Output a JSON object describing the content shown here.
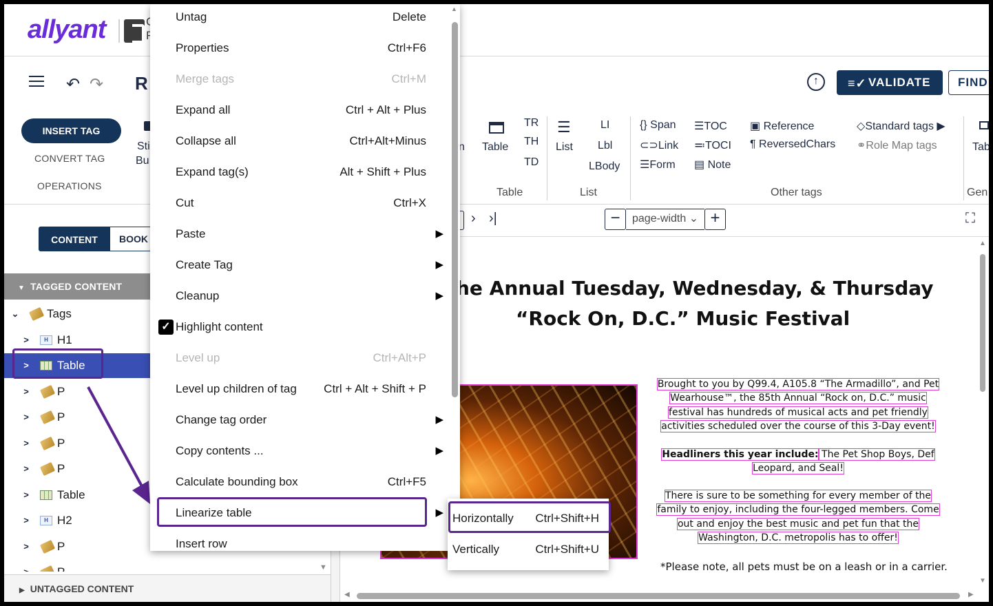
{
  "header": {
    "logo": "allyant",
    "logo_tail": "C\nF",
    "doc_title": "R",
    "validate_label": "VALIDATE",
    "find_label": "FIND"
  },
  "ribbon_left": {
    "insert_tag": "INSERT TAG",
    "convert_tag": "CONVERT TAG",
    "operations": "OPERATIONS",
    "partial_1": "Sti",
    "partial_2": "Bu"
  },
  "ribbon_right": {
    "partial_n": "n",
    "table_btn": "Table",
    "tr": "TR",
    "th": "TH",
    "td": "TD",
    "table_group": "Table",
    "list_btn": "List",
    "li": "LI",
    "lbl": "Lbl",
    "lbody": "LBody",
    "list_group": "List",
    "span": "Span",
    "link": "Link",
    "form": "Form",
    "toc": "TOC",
    "toci": "TOCI",
    "note": "Note",
    "reference": "Reference",
    "reversedchars": "ReversedChars",
    "standard_tags": "Standard tags",
    "role_map_tags": "Role Map tags",
    "other_group": "Other tags",
    "tab_partial": "Tab",
    "gen_partial": "Gen"
  },
  "left_panel": {
    "tab_content": "CONTENT",
    "tab_book": "BOOK",
    "tagged_header": "TAGGED CONTENT",
    "untagged_header": "UNTAGGED CONTENT",
    "tree": [
      {
        "label": "Tags",
        "icon": "tag-icon",
        "level": 0
      },
      {
        "label": "H1",
        "icon": "heading-icon",
        "level": 1
      },
      {
        "label": "Table",
        "icon": "table-icon",
        "level": 1,
        "selected": true
      },
      {
        "label": "P",
        "icon": "tag-icon",
        "level": 1
      },
      {
        "label": "P",
        "icon": "tag-icon",
        "level": 1
      },
      {
        "label": "P",
        "icon": "tag-icon",
        "level": 1
      },
      {
        "label": "P",
        "icon": "tag-icon",
        "level": 1
      },
      {
        "label": "Table",
        "icon": "table-icon",
        "level": 1
      },
      {
        "label": "H2",
        "icon": "heading-icon",
        "level": 1
      },
      {
        "label": "P",
        "icon": "tag-icon",
        "level": 1
      },
      {
        "label": "P",
        "icon": "tag-icon",
        "level": 1
      }
    ]
  },
  "doc_toolbar": {
    "zoom_value": "page-width"
  },
  "document": {
    "heading_1": "he Annual Tuesday, Wednesday, & Thursday",
    "heading_2": "“Rock On, D.C.” Music Festival",
    "para1": [
      "Brought to you by Q99.4, A105.8 “The Armadillo”, and Pet",
      "Wearhouse™, the 85th Annual “Rock on, D.C.” music",
      "festival has hundreds of musical acts and pet friendly",
      "activities scheduled over the course of this 3-Day event!"
    ],
    "para2_bold": "Headliners this year include:",
    "para2_rest": " The Pet Shop Boys, Def",
    "para2_line2": "Leopard, and Seal!",
    "para3": [
      "There is sure to be something for every member of the",
      "family to enjoy, including the four-legged members.  Come",
      "out and enjoy the best music and pet fun that the",
      "Washington, D.C. metropolis has to offer!"
    ],
    "note": "*Please note, all pets must be on a leash or in a carrier."
  },
  "context_menu": [
    {
      "label": "Untag",
      "shortcut": "Delete",
      "disabled": false
    },
    {
      "label": "Properties",
      "shortcut": "Ctrl+F6",
      "disabled": false
    },
    {
      "label": "Merge tags",
      "shortcut": "Ctrl+M",
      "disabled": true
    },
    {
      "label": "Expand all",
      "shortcut": "Ctrl + Alt + Plus",
      "disabled": false
    },
    {
      "label": "Collapse all",
      "shortcut": "Ctrl+Alt+Minus",
      "disabled": false
    },
    {
      "label": "Expand tag(s)",
      "shortcut": "Alt + Shift + Plus",
      "disabled": false
    },
    {
      "label": "Cut",
      "shortcut": "Ctrl+X",
      "disabled": false
    },
    {
      "label": "Paste",
      "shortcut": "",
      "submenu": true,
      "disabled": false
    },
    {
      "label": "Create Tag",
      "shortcut": "",
      "submenu": true,
      "disabled": false
    },
    {
      "label": "Cleanup",
      "shortcut": "",
      "submenu": true,
      "disabled": false
    },
    {
      "label": "Highlight content",
      "shortcut": "",
      "checked": true,
      "disabled": false
    },
    {
      "label": "Level up",
      "shortcut": "Ctrl+Alt+P",
      "disabled": true
    },
    {
      "label": "Level up children of tag",
      "shortcut": "Ctrl + Alt + Shift + P",
      "disabled": false
    },
    {
      "label": "Change tag order",
      "shortcut": "",
      "submenu": true,
      "disabled": false
    },
    {
      "label": "Copy contents ...",
      "shortcut": "",
      "submenu": true,
      "disabled": false
    },
    {
      "label": "Calculate bounding box",
      "shortcut": "Ctrl+F5",
      "disabled": false
    },
    {
      "label": "Linearize table",
      "shortcut": "",
      "submenu": true,
      "disabled": false
    },
    {
      "label": "Insert row",
      "shortcut": "",
      "disabled": false
    }
  ],
  "submenu": [
    {
      "label": "Horizontally",
      "shortcut": "Ctrl+Shift+H"
    },
    {
      "label": "Vertically",
      "shortcut": "Ctrl+Shift+U"
    }
  ],
  "annotation_color": "#5b2590",
  "highlight_color": "#e23ad6",
  "accent_color": "#14345a"
}
